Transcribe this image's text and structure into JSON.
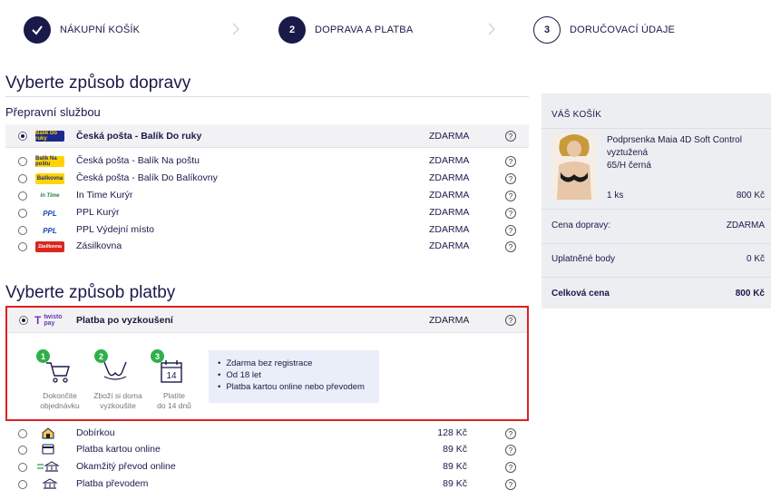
{
  "stepper": {
    "steps": [
      {
        "number": "",
        "label": "NÁKUPNÍ KOŠÍK",
        "state": "done"
      },
      {
        "number": "2",
        "label": "DOPRAVA A PLATBA",
        "state": "active"
      },
      {
        "number": "3",
        "label": "DORUČOVACÍ ÚDAJE",
        "state": "pending"
      }
    ]
  },
  "shipping": {
    "heading": "Vyberte způsob dopravy",
    "subheading": "Přepravní službou",
    "options": [
      {
        "name": "Česká pošta - Balík Do ruky",
        "price": "ZDARMA",
        "logo": "Balík Do ruky",
        "selected": true
      },
      {
        "name": "Česká pošta - Balík Na poštu",
        "price": "ZDARMA",
        "logo": "Balík Na poštu",
        "selected": false
      },
      {
        "name": "Česká pošta - Balík Do Balíkovny",
        "price": "ZDARMA",
        "logo": "Balíkovna",
        "selected": false
      },
      {
        "name": "In Time Kurýr",
        "price": "ZDARMA",
        "logo": "In Time",
        "selected": false
      },
      {
        "name": "PPL Kurýr",
        "price": "ZDARMA",
        "logo": "PPL",
        "selected": false
      },
      {
        "name": "PPL Výdejní místo",
        "price": "ZDARMA",
        "logo": "PPL",
        "selected": false
      },
      {
        "name": "Zásilkovna",
        "price": "ZDARMA",
        "logo": "Zásilkovna",
        "selected": false
      }
    ]
  },
  "payment": {
    "heading": "Vyberte způsob platby",
    "selected_option": {
      "name": "Platba po vyzkoušení",
      "price": "ZDARMA",
      "logo_line1": "twisto",
      "logo_line2": "pay"
    },
    "steps": [
      {
        "number": "1",
        "caption_line1": "Dokončite",
        "caption_line2": "objednávku",
        "icon": "cart-icon"
      },
      {
        "number": "2",
        "caption_line1": "Zboží si doma",
        "caption_line2": "vyzkoušite",
        "icon": "bra-icon"
      },
      {
        "number": "3",
        "caption_line1": "Platíte",
        "caption_line2": "do 14 dnů",
        "icon": "calendar-icon",
        "calendar_day": "14"
      }
    ],
    "benefits": [
      "Zdarma bez registrace",
      "Od 18 let",
      "Platba kartou online nebo převodem"
    ],
    "other_options": [
      {
        "name": "Dobírkou",
        "price": "128 Kč",
        "icon": "home-icon"
      },
      {
        "name": "Platba kartou online",
        "price": "89 Kč",
        "icon": "card-icon"
      },
      {
        "name": "Okamžitý převod online",
        "price": "89 Kč",
        "icon": "bank-transfer-icon"
      },
      {
        "name": "Platba převodem",
        "price": "89 Kč",
        "icon": "bank-icon"
      }
    ]
  },
  "cart": {
    "title": "VÁŠ KOŠÍK",
    "product": {
      "name": "Podprsenka Maia 4D Soft Control vyztužená",
      "variant": "65/H černá",
      "quantity": "1 ks",
      "price": "800 Kč"
    },
    "rows": [
      {
        "label": "Cena dopravy:",
        "value": "ZDARMA"
      },
      {
        "label": "Uplatněné body",
        "value": "0 Kč"
      },
      {
        "label": "Celková cena",
        "value": "800 Kč"
      }
    ]
  },
  "help_glyph": "?",
  "colors": {
    "navy": "#1a1a4a",
    "highlight": "#e02020",
    "step_green": "#2eb04a",
    "card_bg": "#eceef2"
  }
}
